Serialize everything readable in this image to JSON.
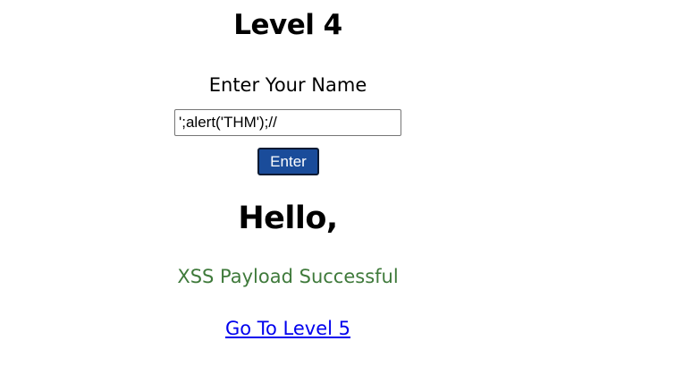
{
  "page": {
    "title": "Level 4",
    "prompt": "Enter Your Name",
    "input": {
      "value": "';alert('THM');//"
    },
    "enter_button": {
      "label": "Enter"
    },
    "greeting": "Hello,",
    "status": "XSS Payload Successful",
    "next_link": "Go To Level 5"
  },
  "colors": {
    "button_bg": "#1a4c9a",
    "button_text": "#ffffff",
    "status_text": "#3f7a3b",
    "link": "#0000ee"
  }
}
